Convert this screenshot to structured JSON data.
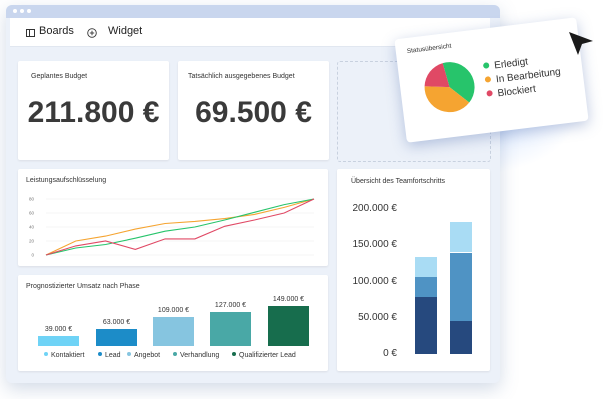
{
  "toolbar": {
    "boards_label": "Boards",
    "widget_label": "Widget"
  },
  "kpi": [
    {
      "title": "Geplantes Budget",
      "value": "211.800 €"
    },
    {
      "title": "Tatsächlich ausgegebenes Budget",
      "value": "69.500 €"
    }
  ],
  "status_popup": {
    "title": "Statusübersicht",
    "items": [
      {
        "label": "Erledigt",
        "color": "#27c46b",
        "share": 0.4
      },
      {
        "label": "In Bearbeitung",
        "color": "#f5a431",
        "share": 0.4
      },
      {
        "label": "Blockiert",
        "color": "#e04965",
        "share": 0.2
      }
    ]
  },
  "chart_data": [
    {
      "type": "line",
      "title": "Leistungsaufschlüsselung",
      "y_ticks": [
        "80",
        "60",
        "40",
        "20",
        "0"
      ],
      "ylim": [
        0,
        80
      ],
      "x": [
        0,
        1,
        2,
        3,
        4,
        5,
        6,
        7,
        8,
        9
      ],
      "series": [
        {
          "color": "#f5a431",
          "values": [
            0,
            20,
            27,
            37,
            45,
            48,
            52,
            58,
            68,
            80
          ]
        },
        {
          "color": "#27c46b",
          "values": [
            0,
            10,
            15,
            24,
            34,
            40,
            50,
            61,
            72,
            80
          ]
        },
        {
          "color": "#e04965",
          "values": [
            0,
            13,
            20,
            8,
            23,
            23,
            41,
            50,
            60,
            80
          ]
        }
      ]
    },
    {
      "type": "bar",
      "title": "Prognostizierter Umsatz nach Phase",
      "categories": [
        "Kontaktiert",
        "Lead",
        "Angebot",
        "Verhandlung",
        "Qualifizierter Lead"
      ],
      "values": [
        39000,
        63000,
        109000,
        127000,
        149000
      ],
      "value_labels": [
        "39.000 €",
        "63.000 €",
        "109.000 €",
        "127.000 €",
        "149.000 €"
      ],
      "colors": [
        "#6fd3f6",
        "#1c8cc8",
        "#86c5e0",
        "#49a8a6",
        "#176d4d"
      ]
    },
    {
      "type": "bar",
      "title": "Übersicht des Teamfortschritts",
      "y_ticks": [
        "200.000 €",
        "150.000 €",
        "100.000 €",
        "50.000 €",
        "0 €"
      ],
      "ylim": [
        0,
        200000
      ],
      "stacked": true,
      "series_colors": [
        "#26497e",
        "#4f93c4",
        "#a9dcf4"
      ],
      "stacks": [
        [
          78000,
          28000,
          28000
        ],
        [
          45000,
          95000,
          42000
        ]
      ]
    }
  ]
}
